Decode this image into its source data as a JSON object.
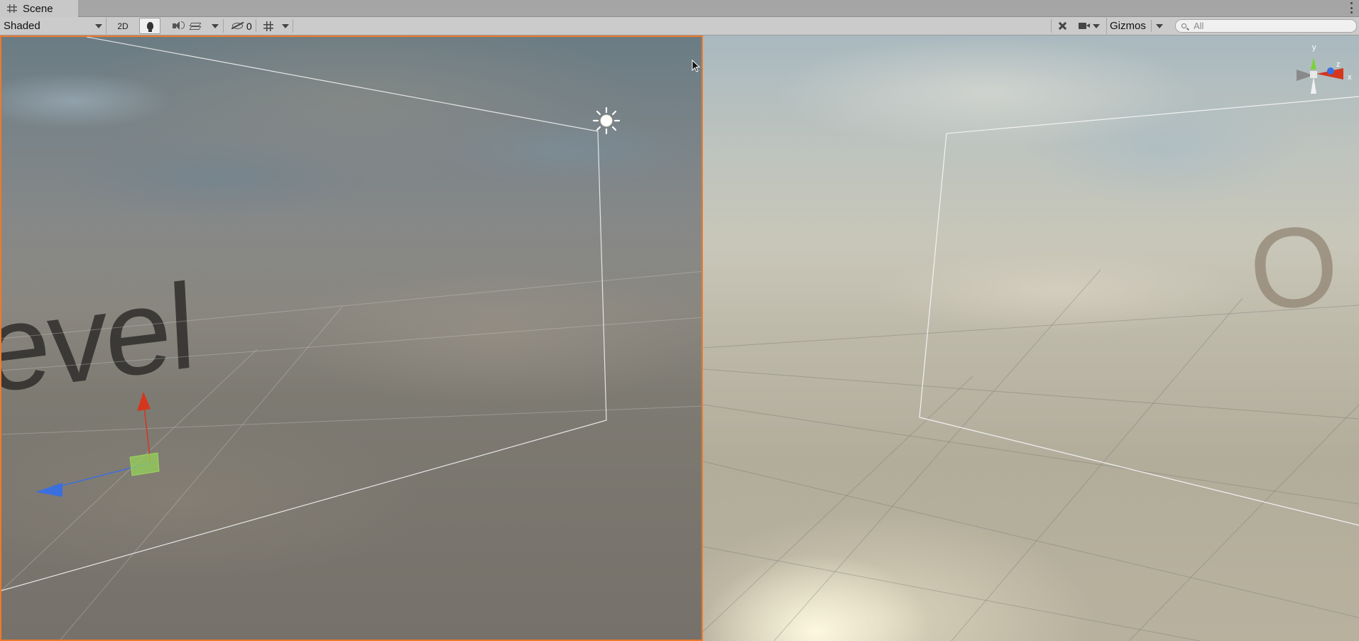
{
  "window": {
    "tab_title": "Scene"
  },
  "toolbar": {
    "draw_mode": "Shaded",
    "mode_2d_label": "2D",
    "hidden_count": "0",
    "gizmos_label": "Gizmos",
    "search_placeholder": "All"
  },
  "scene_left": {
    "world_text": "evel"
  },
  "scene_right": {
    "world_text": "O"
  },
  "orientation_gizmo": {
    "y_label": "y",
    "z_label": "z",
    "x_label": "x"
  },
  "colors": {
    "selected_view_border": "#ee7a2a",
    "axis_x": "#d5361e",
    "axis_y": "#7bd23a",
    "axis_z": "#3b6fe0"
  }
}
